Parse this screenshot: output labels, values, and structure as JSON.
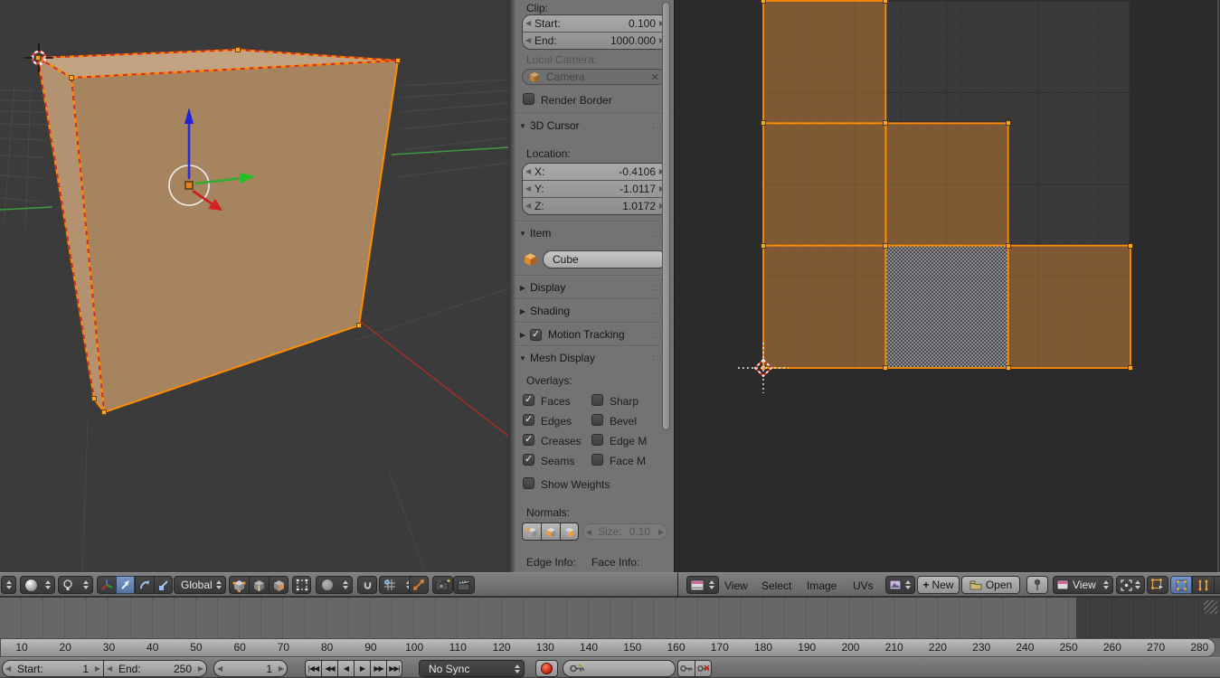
{
  "colors": {
    "selection_orange": "#ff8c00",
    "uv_vertex_orange": "#ffa228",
    "active_tool_blue": "#5e82b4",
    "seam_red": "#cf2d20",
    "axis_x_red": "#b92b20",
    "axis_y_green": "#3f9c3f",
    "axis_z_blue": "#2a2ae0",
    "record_red": "#c02312",
    "cube_top_face": "#c2a381",
    "cube_left_face": "#b39272",
    "cube_front_face": "#a5845f",
    "uv_face_fill": "#7a5a38"
  },
  "icons": {
    "tri_open": "▼",
    "tri_closed": "▶",
    "close": "✕",
    "plus": "+"
  },
  "properties_panel": {
    "clip_label": "Clip:",
    "clip_start": {
      "label": "Start:",
      "value": "0.100"
    },
    "clip_end": {
      "label": "End:",
      "value": "1000.000"
    },
    "local_camera_label": "Local Camera:",
    "camera_field_value": "Camera",
    "render_border_label": "Render Border",
    "render_border_checked": false,
    "cursor_panel_title": "3D Cursor",
    "location_label": "Location:",
    "loc_x": {
      "label": "X:",
      "value": "-0.4106"
    },
    "loc_y": {
      "label": "Y:",
      "value": "-1.0117"
    },
    "loc_z": {
      "label": "Z:",
      "value": "1.0172"
    },
    "item_panel_title": "Item",
    "item_name": "Cube",
    "display_panel_title": "Display",
    "shading_panel_title": "Shading",
    "motion_tracking_panel_title": "Motion Tracking",
    "motion_tracking_checked": true,
    "mesh_display_panel_title": "Mesh Display",
    "overlays_label": "Overlays:",
    "overlays": [
      {
        "label": "Faces",
        "checked": true
      },
      {
        "label": "Sharp",
        "checked": false
      },
      {
        "label": "Edges",
        "checked": true
      },
      {
        "label": "Bevel",
        "checked": false
      },
      {
        "label": "Creases",
        "checked": true
      },
      {
        "label": "Edge M",
        "checked": false
      },
      {
        "label": "Seams",
        "checked": true
      },
      {
        "label": "Face M",
        "checked": false
      }
    ],
    "show_weights_label": "Show Weights",
    "show_weights_checked": false,
    "normals_label": "Normals:",
    "size_field": {
      "label": "Size:",
      "value": "0.10"
    },
    "edge_info_label": "Edge Info:",
    "face_info_label": "Face Info:"
  },
  "viewport3d_header": {
    "orientation_mode": "Global"
  },
  "uv_editor": {
    "menus": [
      "View",
      "Select",
      "Image",
      "UVs"
    ],
    "new_label": "New",
    "open_label": "Open",
    "view_dropdown_label": "View",
    "faces": [
      {
        "col": 0,
        "row": 0,
        "active": false
      },
      {
        "col": 0,
        "row": 1,
        "active": false
      },
      {
        "col": 1,
        "row": 1,
        "active": false
      },
      {
        "col": 0,
        "row": 2,
        "active": false
      },
      {
        "col": 1,
        "row": 2,
        "active": true
      },
      {
        "col": 2,
        "row": 2,
        "active": false
      }
    ]
  },
  "timeline": {
    "ruler_numbers": [
      "10",
      "20",
      "30",
      "40",
      "50",
      "60",
      "70",
      "80",
      "90",
      "100",
      "110",
      "120",
      "130",
      "140",
      "150",
      "160",
      "170",
      "180",
      "190",
      "200",
      "210",
      "220",
      "230",
      "240",
      "250",
      "260",
      "270",
      "280"
    ],
    "start_label": "Start:",
    "start_value": "1",
    "end_label": "End:",
    "end_value": "250",
    "current_frame": "1",
    "sync_mode": "No Sync",
    "playback_glyphs": [
      "|◀◀",
      "◀◀",
      "◀",
      "▶",
      "▶▶",
      "▶▶|"
    ]
  }
}
